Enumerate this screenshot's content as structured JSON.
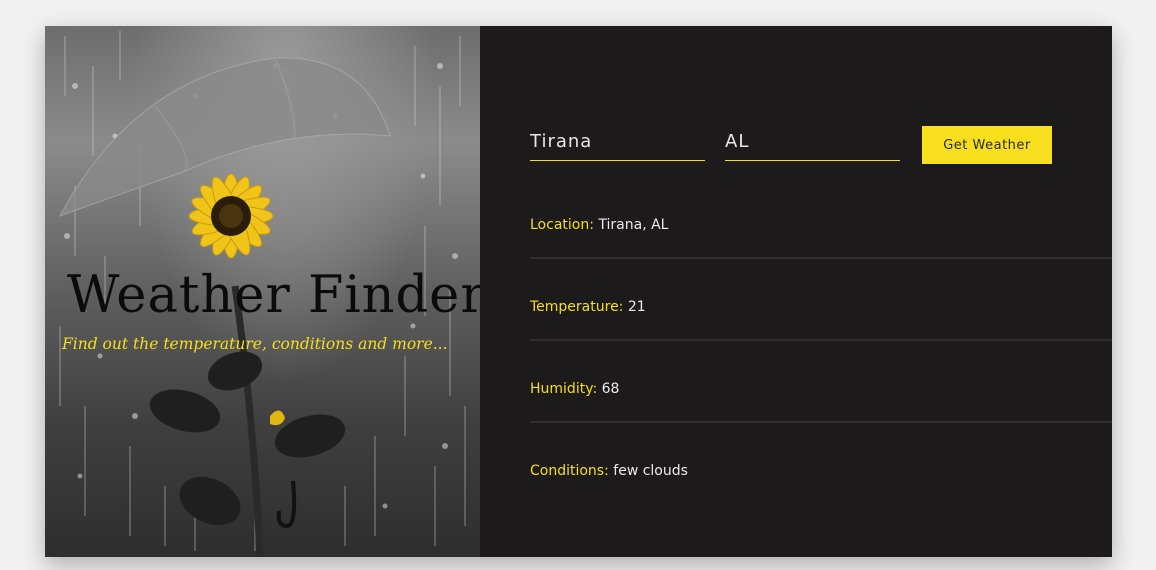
{
  "hero": {
    "title": "Weather Finder",
    "subtitle": "Find out the temperature, conditions and more..."
  },
  "form": {
    "city_value": "Tirana",
    "country_value": "AL",
    "submit_label": "Get Weather"
  },
  "results": [
    {
      "label": "Location:",
      "value": "Tirana, AL"
    },
    {
      "label": "Temperature:",
      "value": "21"
    },
    {
      "label": "Humidity:",
      "value": "68"
    },
    {
      "label": "Conditions:",
      "value": "few clouds"
    }
  ],
  "colors": {
    "accent": "#f7df1e",
    "panel_bg": "#1c1a1b",
    "page_bg": "#f1f1f1"
  },
  "icons": [
    "umbrella-icon",
    "sunflower-icon"
  ]
}
